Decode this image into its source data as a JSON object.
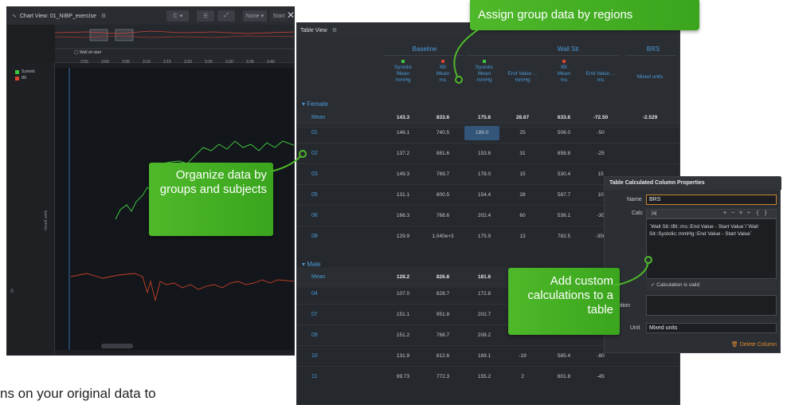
{
  "chart_view": {
    "title": "Chart View: 01_NIBP_exercise",
    "btn_mode": "Ⓒ ▾",
    "btn_start": "Start",
    "btn_none": "None ▾",
    "marker_label": "Wall sit start",
    "time_ticks": [
      "2:55",
      "3:00",
      "3:05",
      "3:10",
      "3:15",
      "3:20",
      "3:25",
      "3:30",
      "3:35",
      "3:40"
    ],
    "legend": [
      {
        "name": "Systolic",
        "color": "#3fc23f"
      },
      {
        "name": "IBI",
        "color": "#d9452f"
      }
    ],
    "y_axis_label": "mixed units",
    "left_marker": "S"
  },
  "table_view": {
    "title": "Table View",
    "groups": [
      "Baseline",
      "Wall Sit",
      "BRS"
    ],
    "columns": [
      {
        "channel": "Systolic",
        "stat": "Mean",
        "unit": "mmHg",
        "color": "#3fc23f"
      },
      {
        "channel": "IBI",
        "stat": "Mean",
        "unit": "ms",
        "color": "#d9452f"
      },
      {
        "channel": "Systolic",
        "stat": "Mean",
        "unit": "mmHg",
        "color": "#3fc23f"
      },
      {
        "channel": "",
        "stat": "End Value ...",
        "unit": "mmHg",
        "color": ""
      },
      {
        "channel": "IBI",
        "stat": "Mean",
        "unit": "ms",
        "color": "#d9452f"
      },
      {
        "channel": "",
        "stat": "End Value ...",
        "unit": "ms",
        "color": ""
      },
      {
        "channel": "",
        "stat": "Mixed units",
        "unit": "",
        "color": ""
      }
    ],
    "female": {
      "label": "Female",
      "mean_label": "Mean",
      "mean": [
        "143.3",
        "833.6",
        "175.6",
        "28.67",
        "633.6",
        "-72.50",
        "-2.529"
      ],
      "rows": [
        {
          "id": "01",
          "v": [
            "146.1",
            "740.5",
            "189.0",
            "25",
            "506.0",
            "-50"
          ]
        },
        {
          "id": "02",
          "v": [
            "137.2",
            "881.6",
            "153.8",
            "31",
            "858.8",
            "-25"
          ]
        },
        {
          "id": "03",
          "v": [
            "149.3",
            "769.7",
            "178.0",
            "15",
            "530.4",
            "15"
          ]
        },
        {
          "id": "05",
          "v": [
            "131.1",
            "800.5",
            "154.4",
            "28",
            "587.7",
            "10"
          ]
        },
        {
          "id": "06",
          "v": [
            "166.3",
            "768.6",
            "202.4",
            "60",
            "536.1",
            "-30"
          ]
        },
        {
          "id": "08",
          "v": [
            "129.9",
            "1.040e+3",
            "175.9",
            "13",
            "782.5",
            "-350"
          ]
        }
      ]
    },
    "male": {
      "label": "Male",
      "mean_label": "Mean",
      "mean": [
        "128.2",
        "826.8",
        "181.6"
      ],
      "rows": [
        {
          "id": "04",
          "v": [
            "107.0",
            "828.7",
            "172.8",
            "",
            "",
            ""
          ]
        },
        {
          "id": "07",
          "v": [
            "151.1",
            "951.8",
            "202.7",
            "",
            "",
            ""
          ]
        },
        {
          "id": "09",
          "v": [
            "151.2",
            "768.7",
            "208.2",
            "",
            "",
            ""
          ]
        },
        {
          "id": "10",
          "v": [
            "131.9",
            "812.6",
            "169.1",
            "-19",
            "585.4",
            "-80"
          ]
        },
        {
          "id": "11",
          "v": [
            "99.73",
            "772.3",
            "155.2",
            "2",
            "601.8",
            "-45"
          ]
        }
      ]
    }
  },
  "properties": {
    "title": "Table Calculated Column Properties",
    "name_label": "Name",
    "name_value": "BRS",
    "calc_label": "Calc",
    "calc_tool": "|a|",
    "calc_ops": [
      "+",
      "−",
      "×",
      "÷",
      "(",
      ")"
    ],
    "calc_text": "`Wall Sit::IBI::ms::End Value - Start Value`/`Wall Sit::Systolic::mmHg::End Value - Start Value`",
    "valid_text": "✓ Calculation is valid",
    "description_label": "scription",
    "unit_label": "Unit",
    "unit_value": "Mixed units",
    "delete_label": "🗑 Delete Column"
  },
  "callouts": {
    "assign": "Assign group data by regions",
    "organize": "Organize data by groups and subjects",
    "custom": "Add custom calculations to a table"
  },
  "bottom_text": "ns on your original data to"
}
